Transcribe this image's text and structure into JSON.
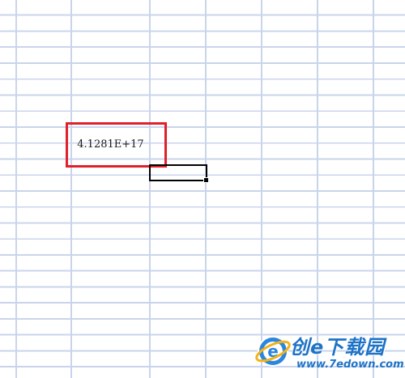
{
  "spreadsheet": {
    "cell_value": "4.1281E+17"
  },
  "highlight": {
    "color": "#e0202a"
  },
  "gridline_color": "#c9d4ec",
  "watermark": {
    "title": "创e下载园",
    "url": "www.7edown.com",
    "brand_color": "#1e73c7",
    "icon": "ie-logo-icon"
  }
}
